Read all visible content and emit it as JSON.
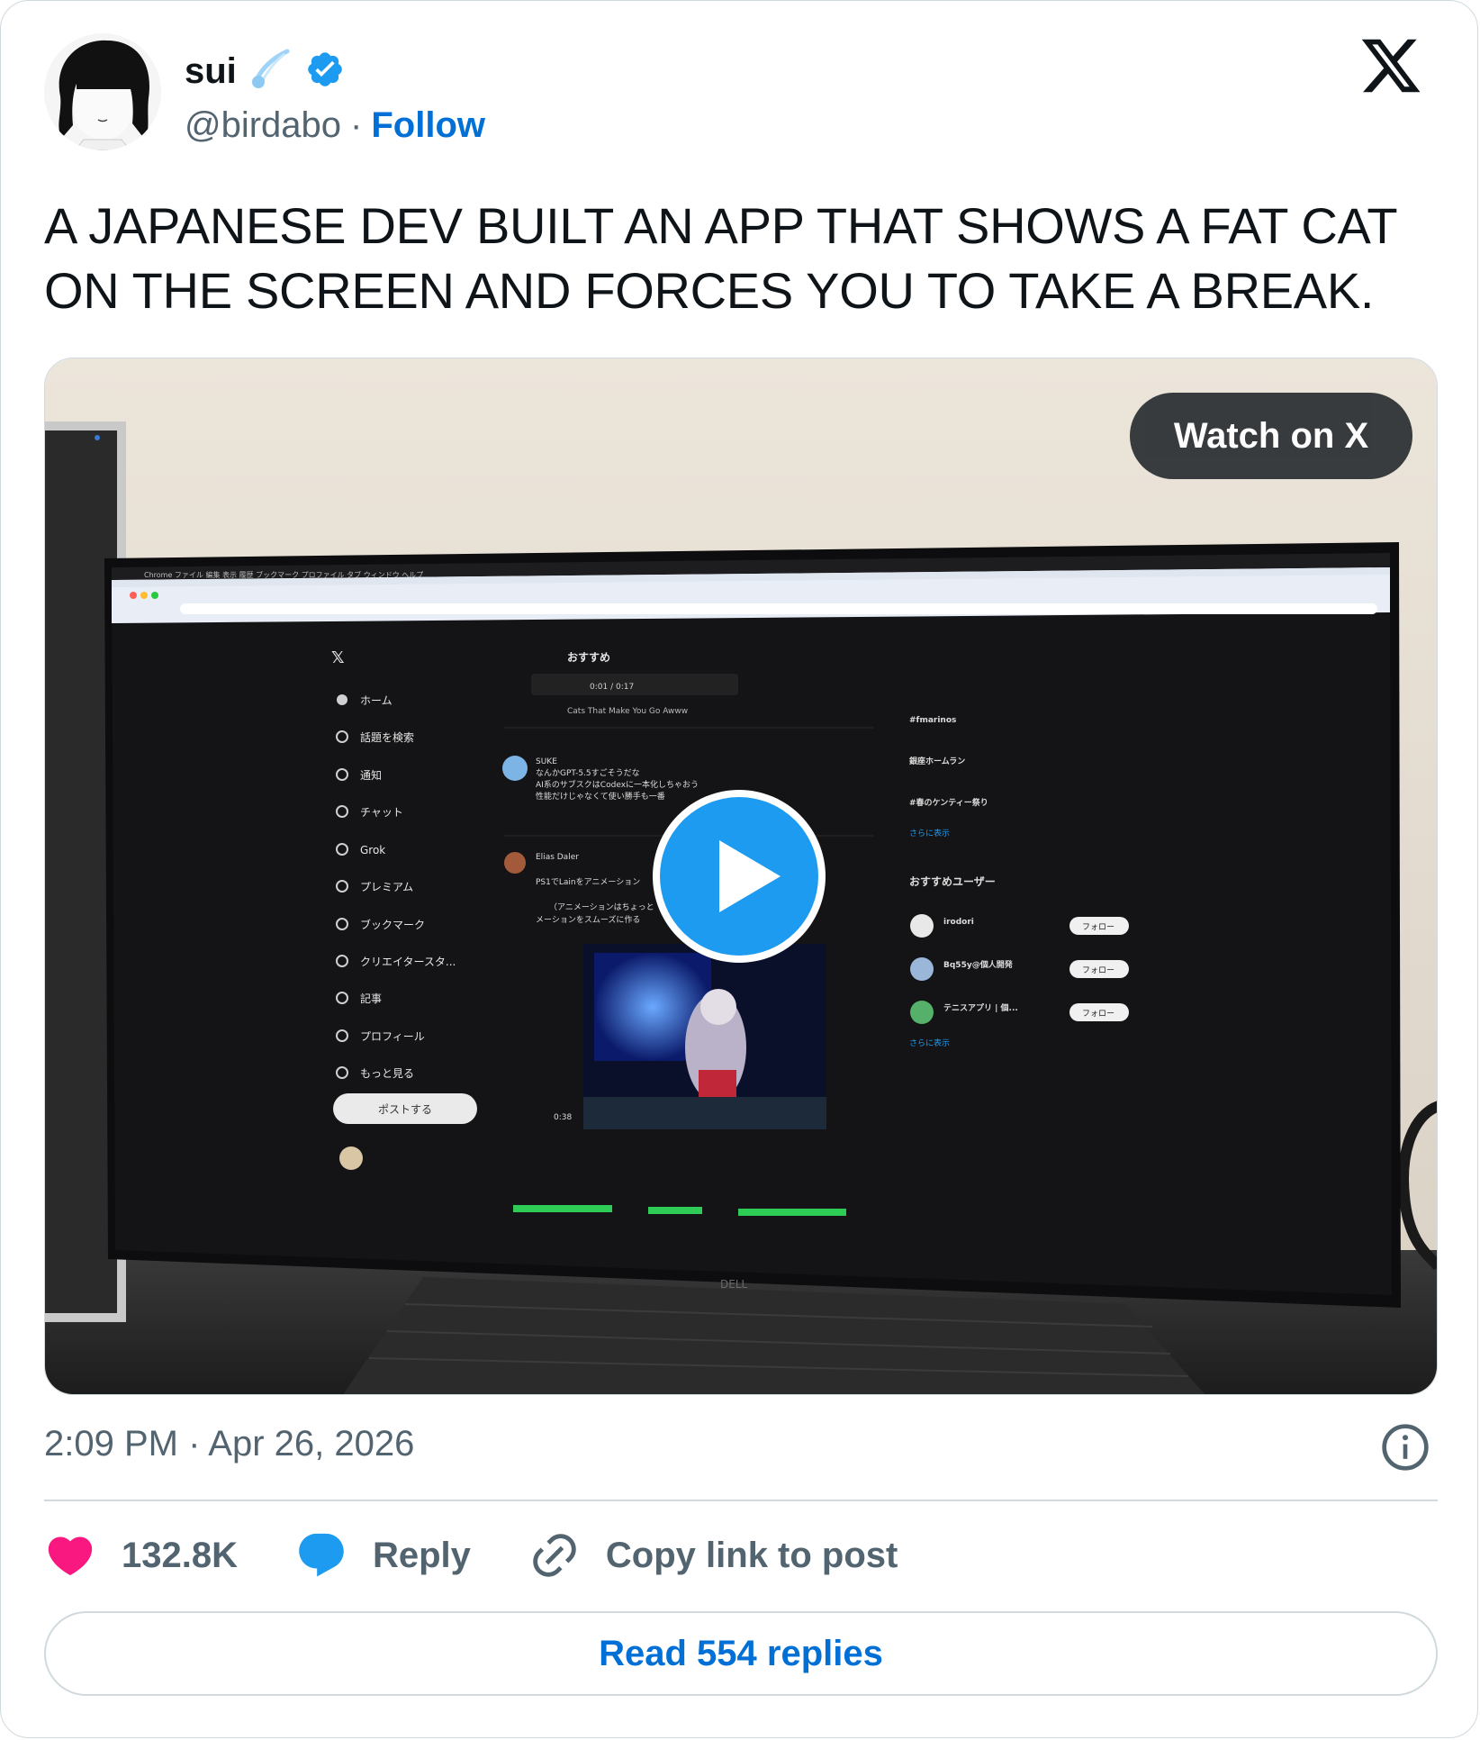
{
  "author": {
    "display_name": "sui",
    "handle": "@birdabo",
    "separator": "·",
    "follow_label": "Follow",
    "verified": true
  },
  "tweet": {
    "text": "A JAPANESE DEV BUILT AN APP THAT SHOWS A FAT CAT ON THE SCREEN AND FORCES YOU TO TAKE A BREAK."
  },
  "media": {
    "type": "video",
    "watch_label": "Watch on X",
    "screen": {
      "nav_items": [
        "ホーム",
        "話題を検索",
        "通知",
        "チャット",
        "Grok",
        "プレミアム",
        "ブックマーク",
        "クリエイタースタ...",
        "記事",
        "プロフィール",
        "もっと見る"
      ],
      "post_button": "ポストする",
      "feed_tab": "おすすめ",
      "video_time": "0:01 / 0:17",
      "video_caption": "Cats That Make You Go Awww",
      "recommended_title": "おすすめユーザー",
      "follow_chip": "フォロー",
      "show_more": "さらに表示",
      "trends": [
        "#fmarinos",
        "銀座ホームラン",
        "#春のケンティー祭り"
      ]
    }
  },
  "meta": {
    "timestamp": "2:09 PM · Apr 26, 2026"
  },
  "actions": {
    "likes": "132.8K",
    "reply_label": "Reply",
    "copy_label": "Copy link to post"
  },
  "read_replies_label": "Read 554 replies",
  "colors": {
    "follow_blue": "#006fd6",
    "like_pink": "#f91880",
    "reply_blue": "#1d9bf0",
    "verified_blue": "#1d9bf0"
  }
}
